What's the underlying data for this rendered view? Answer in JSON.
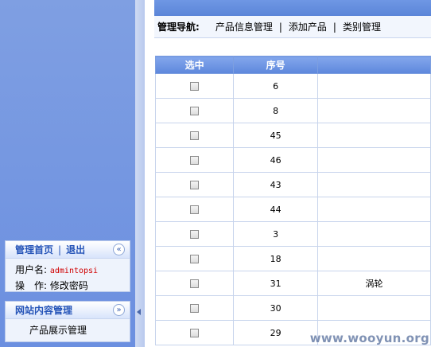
{
  "sidebar": {
    "admin_panel": {
      "home_label": "管理首页",
      "separator": "|",
      "logout_label": "退出",
      "toggle_icon": "«",
      "username_label": "用户名:",
      "username_value": "admintopsi",
      "operation_label": "操　作:",
      "operation_value": "修改密码"
    },
    "content_panel": {
      "title": "网站内容管理",
      "toggle_icon": "»",
      "items": [
        {
          "label": "产品展示管理"
        }
      ]
    }
  },
  "nav": {
    "title": "管理导航:",
    "links": [
      {
        "label": "产品信息管理"
      },
      {
        "label": "添加产品"
      },
      {
        "label": "类别管理"
      }
    ],
    "separator": "|"
  },
  "table": {
    "headers": [
      "选中",
      "序号",
      ""
    ],
    "rows": [
      {
        "id": "6",
        "rest": ""
      },
      {
        "id": "8",
        "rest": ""
      },
      {
        "id": "45",
        "rest": ""
      },
      {
        "id": "46",
        "rest": ""
      },
      {
        "id": "43",
        "rest": ""
      },
      {
        "id": "44",
        "rest": ""
      },
      {
        "id": "3",
        "rest": ""
      },
      {
        "id": "18",
        "rest": ""
      },
      {
        "id": "31",
        "rest": "涡轮"
      },
      {
        "id": "30",
        "rest": ""
      },
      {
        "id": "29",
        "rest": ""
      }
    ]
  },
  "watermark": "www.wooyun.org"
}
